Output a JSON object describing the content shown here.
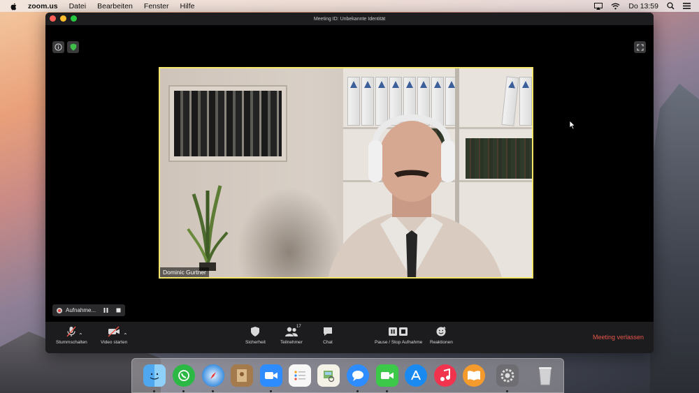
{
  "menubar": {
    "app_name": "zoom.us",
    "menus": [
      "Datei",
      "Bearbeiten",
      "Fenster",
      "Hilfe"
    ],
    "clock": "Do  13:59"
  },
  "window": {
    "title": "Meeting ID: Unbekannte Identität"
  },
  "video": {
    "participant_name": "Dominic Gurtner"
  },
  "recording": {
    "label": "Aufnahme..."
  },
  "toolbar": {
    "mute_label": "Stummschalten",
    "video_label": "Video starten",
    "security_label": "Sicherheit",
    "participants_label": "Teilnehmer",
    "participants_count": "17",
    "chat_label": "Chat",
    "record_label": "Pause / Stop Aufnahme",
    "reactions_label": "Reaktionen",
    "leave_label": "Meeting verlassen",
    "leave_color": "#e8554a"
  },
  "dock": {
    "apps": [
      "finder-icon",
      "whatsapp-icon",
      "safari-icon",
      "contacts-icon",
      "zoom-icon",
      "reminders-icon",
      "preview-icon",
      "messages-icon",
      "facetime-icon",
      "appstore-icon",
      "music-icon",
      "books-icon",
      "system-preferences-icon",
      "trash-icon"
    ]
  }
}
